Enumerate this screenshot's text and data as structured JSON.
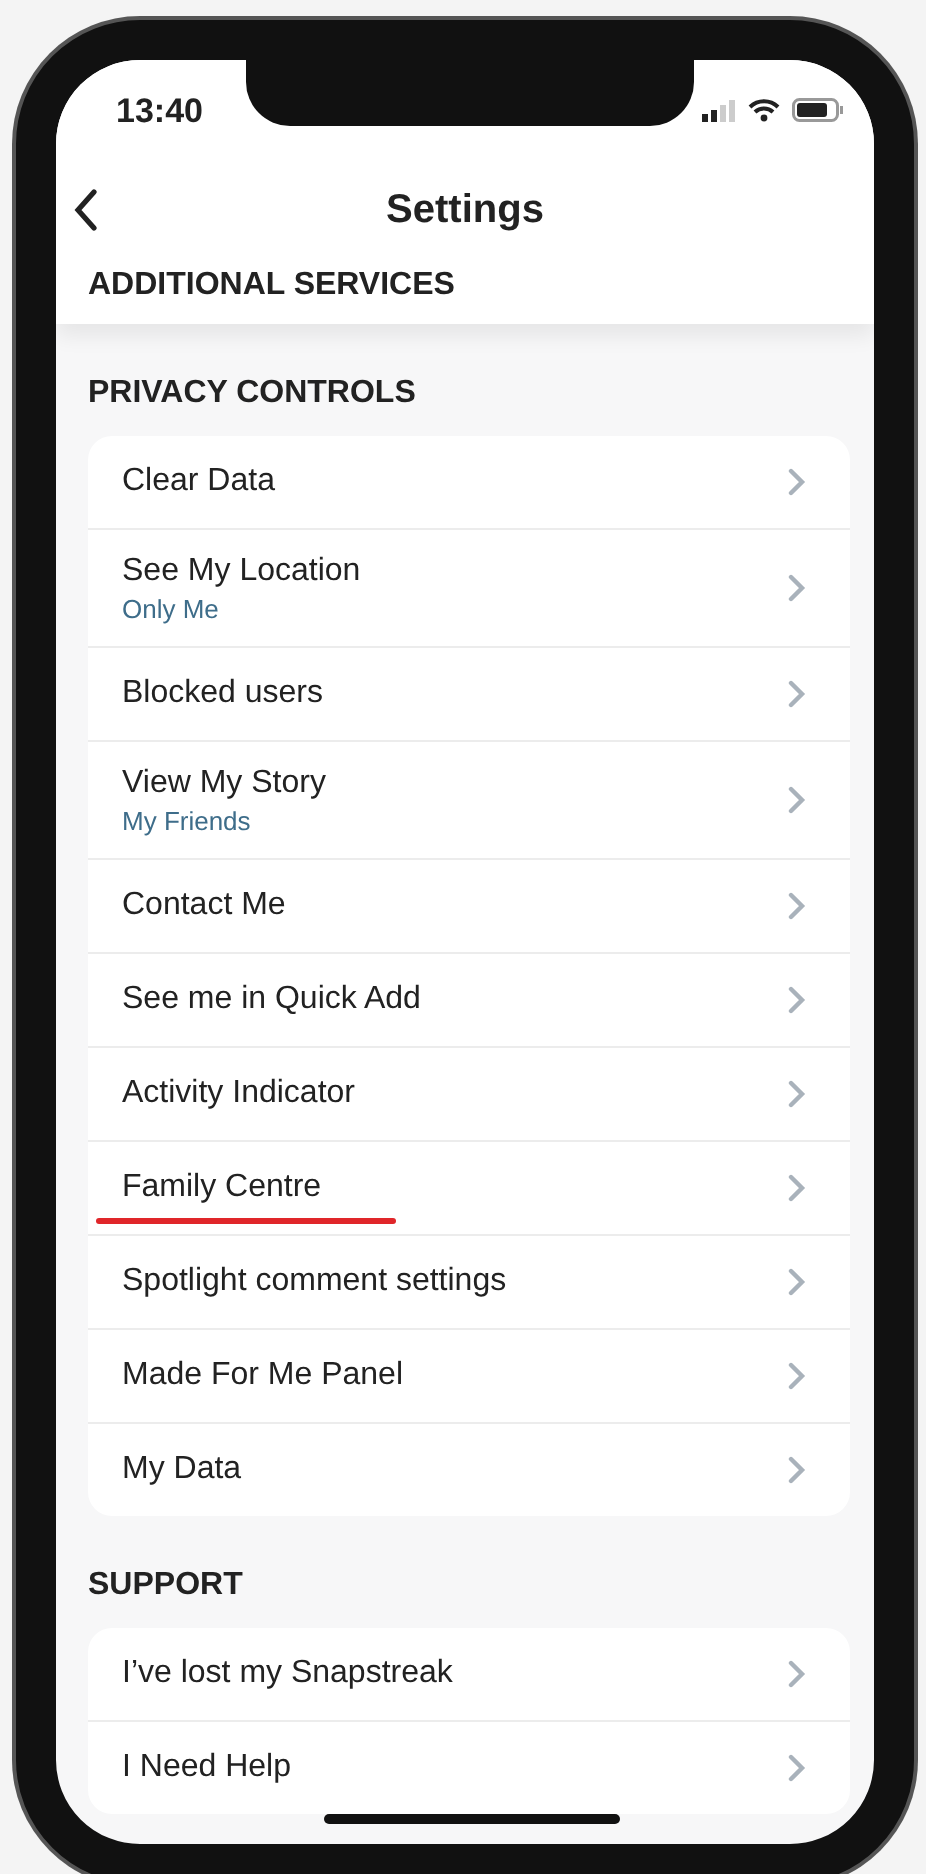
{
  "status_bar": {
    "time": "13:40"
  },
  "nav": {
    "title": "Settings"
  },
  "sections": [
    {
      "title": "ADDITIONAL SERVICES"
    },
    {
      "title": "PRIVACY CONTROLS",
      "items": [
        {
          "label": "Clear Data",
          "marked": false
        },
        {
          "label": "See My Location",
          "value": "Only Me",
          "marked": false
        },
        {
          "label": "Blocked users",
          "marked": false
        },
        {
          "label": "View My Story",
          "value": "My Friends",
          "marked": false
        },
        {
          "label": "Contact Me",
          "marked": false
        },
        {
          "label": "See me in Quick Add",
          "marked": false
        },
        {
          "label": "Activity Indicator",
          "marked": false
        },
        {
          "label": "Family Centre",
          "marked": true
        },
        {
          "label": "Spotlight comment settings",
          "marked": false
        },
        {
          "label": "Made For Me Panel",
          "marked": false
        },
        {
          "label": "My Data",
          "marked": false
        }
      ]
    },
    {
      "title": "SUPPORT",
      "items": [
        {
          "label": "I’ve lost my Snapstreak",
          "marked": false
        },
        {
          "label": "I Need Help",
          "marked": false
        }
      ]
    }
  ]
}
